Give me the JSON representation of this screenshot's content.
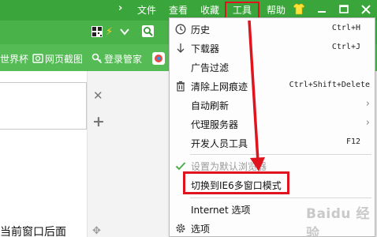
{
  "titlebar": {
    "menus": [
      {
        "label": "文件"
      },
      {
        "label": "查看"
      },
      {
        "label": "收藏"
      },
      {
        "label": "工具"
      }
    ],
    "help": "帮助"
  },
  "bookmarks": [
    {
      "label": "世界杯"
    },
    {
      "label": "网页截图"
    },
    {
      "label": "登录管家"
    }
  ],
  "content": {
    "bottom_text": "当前窗口后面"
  },
  "tools_menu": {
    "items": [
      {
        "label": "历史",
        "shortcut": "Ctrl+H"
      },
      {
        "label": "下载器",
        "shortcut": "Ctrl+J"
      },
      {
        "label": "广告过滤"
      },
      {
        "label": "清除上网痕迹",
        "shortcut": "Ctrl+Shift+Delete"
      },
      {
        "label": "自动刷新"
      },
      {
        "label": "代理服务器"
      },
      {
        "label": "开发人员工具",
        "shortcut": "F12"
      },
      {
        "label": "设置为默认浏览器"
      },
      {
        "label": "切换到IE6多窗口模式"
      },
      {
        "label": "Internet 选项"
      },
      {
        "label": "选项"
      }
    ]
  },
  "watermark": "Baidu 经验",
  "colors": {
    "titlebar": "#3aa53a",
    "toolbar": "#49b249",
    "bookmarks": "#55bb55",
    "highlight": "#e0141e"
  }
}
